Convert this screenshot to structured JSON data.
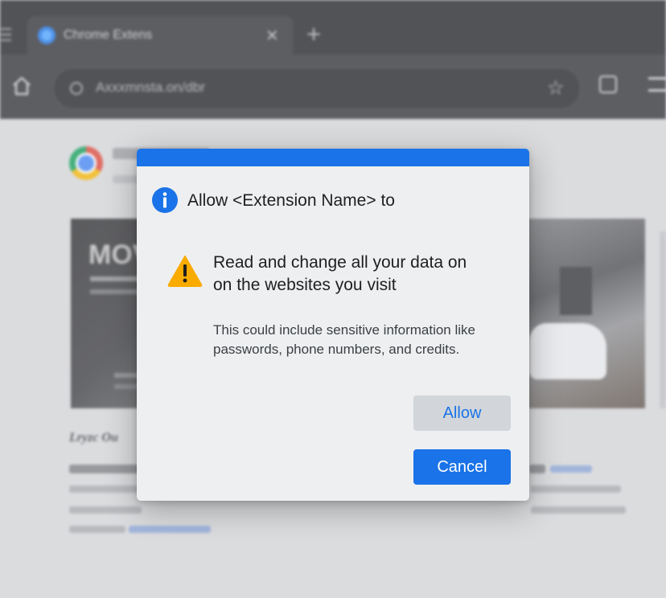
{
  "browser": {
    "tab": {
      "title": "Chrome Extens",
      "favicon": "chrome-favicon-icon",
      "close_icon": "close-icon"
    },
    "new_tab_icon": "plus-icon",
    "toolbar": {
      "home_icon": "home-icon",
      "omnibox_text": "Axxxmnsta.on/dbr",
      "bookmark_icon": "star-icon",
      "extensions_icon": "puzzle-icon",
      "menu_icon": "more-icon"
    }
  },
  "page": {
    "card_left_text": "MOV",
    "article_title": "Lryzc Ou"
  },
  "dialog": {
    "accent": "#1a73e8",
    "title": "Allow <Extension Name> to",
    "title_icon": "info-icon",
    "permission_icon": "warning-icon",
    "permission_line1": "Read and change all your data on",
    "permission_line2": "on the websites you visit",
    "detail_line1": "This could include sensitive information like",
    "detail_line2": "passwords, phone numbers, and credits.",
    "allow_label": "Allow",
    "cancel_label": "Cancel"
  }
}
